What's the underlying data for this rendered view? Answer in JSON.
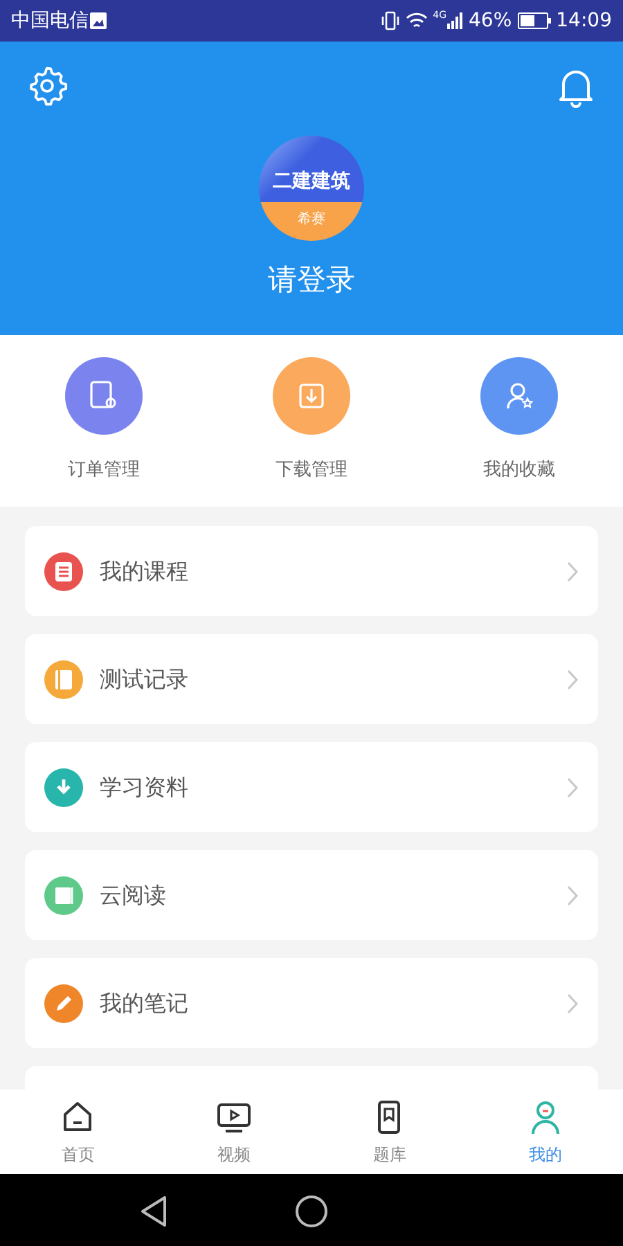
{
  "status_bar": {
    "carrier": "中国电信",
    "network": "4G",
    "battery": "46%",
    "time": "14:09"
  },
  "header": {
    "logo_title": "二建建筑",
    "logo_subtitle": "希赛",
    "login": "请登录"
  },
  "quick_actions": [
    {
      "label": "订单管理",
      "kind": "order",
      "color": "#7b84ee"
    },
    {
      "label": "下载管理",
      "kind": "download",
      "color": "#fba95c"
    },
    {
      "label": "我的收藏",
      "kind": "favorite",
      "color": "#5f95f2"
    }
  ],
  "menu": [
    {
      "label": "我的课程",
      "kind": "list",
      "color": "#e8534f"
    },
    {
      "label": "测试记录",
      "kind": "notebook",
      "color": "#f5a93a"
    },
    {
      "label": "学习资料",
      "kind": "download",
      "color": "#27b5ac"
    },
    {
      "label": "云阅读",
      "kind": "reader",
      "color": "#5fc98a"
    },
    {
      "label": "我的笔记",
      "kind": "pencil",
      "color": "#f0862a"
    }
  ],
  "tabs": [
    {
      "label": "首页",
      "kind": "home",
      "selected": false
    },
    {
      "label": "视频",
      "kind": "video",
      "selected": false
    },
    {
      "label": "题库",
      "kind": "bank",
      "selected": false
    },
    {
      "label": "我的",
      "kind": "me",
      "selected": true
    }
  ]
}
